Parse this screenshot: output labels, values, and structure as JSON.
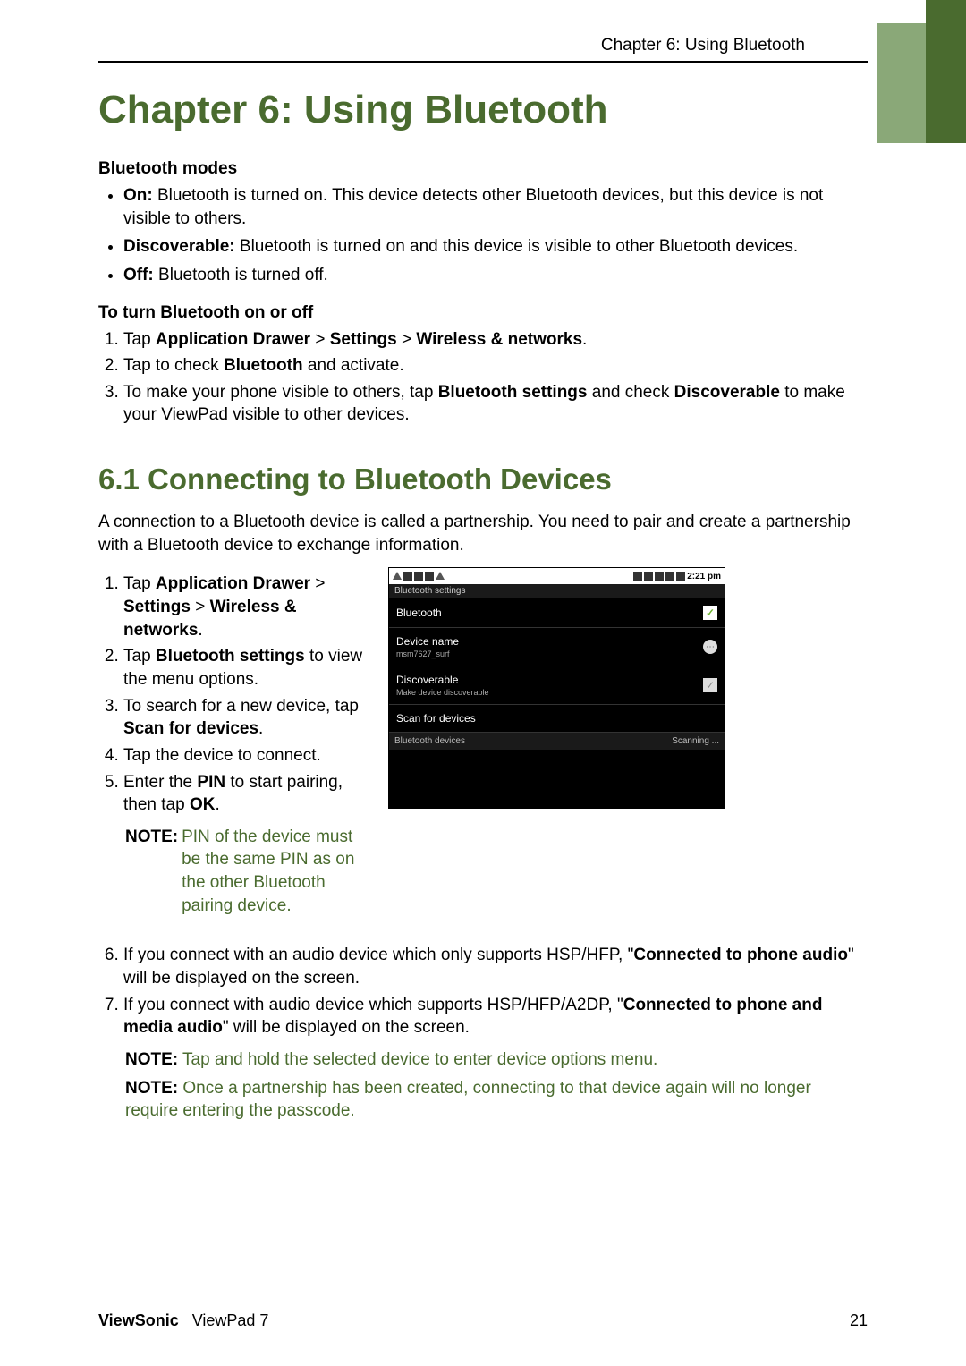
{
  "header": "Chapter 6: Using Bluetooth",
  "chapter_title": "Chapter 6: Using Bluetooth",
  "bluetooth_modes": {
    "heading": "Bluetooth modes",
    "items": [
      {
        "label": "On:",
        "text": " Bluetooth is turned on. This device detects other Bluetooth devices, but this device is not visible to others."
      },
      {
        "label": "Discoverable:",
        "text": " Bluetooth is turned on and this device is visible to other Bluetooth devices."
      },
      {
        "label": "Off:",
        "text": " Bluetooth is turned off."
      }
    ]
  },
  "turn_on_off": {
    "heading": "To turn Bluetooth on or off",
    "step1": {
      "pre": "Tap ",
      "b1": "Application Drawer",
      "sep1": " > ",
      "b2": "Settings",
      "sep2": " > ",
      "b3": "Wireless & networks",
      "post": "."
    },
    "step2": {
      "pre": "Tap to check ",
      "b1": "Bluetooth",
      "post": " and activate."
    },
    "step3": {
      "pre": "To make your phone visible to others, tap ",
      "b1": "Bluetooth settings",
      "mid": " and check ",
      "b2": "Discoverable",
      "post": " to make your ViewPad visible to other devices."
    }
  },
  "section_6_1": {
    "title": "6.1 Connecting to Bluetooth Devices",
    "intro": "A connection to a Bluetooth device is called a partnership. You need to pair and create a partnership with a Bluetooth device to exchange information.",
    "left_steps": {
      "s1": {
        "pre": "Tap ",
        "b1": "Application Drawer",
        "sep1": " > ",
        "b2": "Settings",
        "sep2": " > ",
        "b3": "Wireless & networks",
        "post": "."
      },
      "s2": {
        "pre": "Tap ",
        "b1": "Bluetooth settings",
        "post": " to view the menu options."
      },
      "s3": {
        "pre": "To search for a new device, tap ",
        "b1": "Scan for devices",
        "post": "."
      },
      "s4": "Tap the device to connect.",
      "s5": {
        "pre": "Enter the ",
        "b1": "PIN",
        "mid": " to start pairing, then tap ",
        "b2": "OK",
        "post": "."
      }
    },
    "note1": {
      "label": "NOTE:",
      "text": " PIN of the device must be the same PIN as on the other Bluetooth pairing device."
    },
    "s6": {
      "pre": "If you connect with an audio device which only supports HSP/HFP, \"",
      "b1": "Connected to phone audio",
      "post": "\" will be displayed on the screen."
    },
    "s7": {
      "pre": " If you connect with audio device which supports HSP/HFP/A2DP, \"",
      "b1": "Connected to phone and media audio",
      "post": "\" will be displayed on the screen."
    },
    "note2": {
      "label": "NOTE:",
      "text": " Tap and hold the selected device to enter device options menu."
    },
    "note3": {
      "label": "NOTE:",
      "text": " Once a partnership has been created, connecting to that device again will no longer require entering the passcode."
    }
  },
  "screenshot": {
    "title_bar": "Bluetooth settings",
    "time": "2:21 pm",
    "rows": {
      "bluetooth": "Bluetooth",
      "device_name": "Device name",
      "device_name_sub": "msm7627_surf",
      "discoverable": "Discoverable",
      "discoverable_sub": "Make device discoverable",
      "scan": "Scan for devices",
      "bt_devices": "Bluetooth devices",
      "scanning": "Scanning ..."
    }
  },
  "footer": {
    "brand_bold": "ViewSonic",
    "brand_rest": "ViewPad 7",
    "page": "21"
  }
}
